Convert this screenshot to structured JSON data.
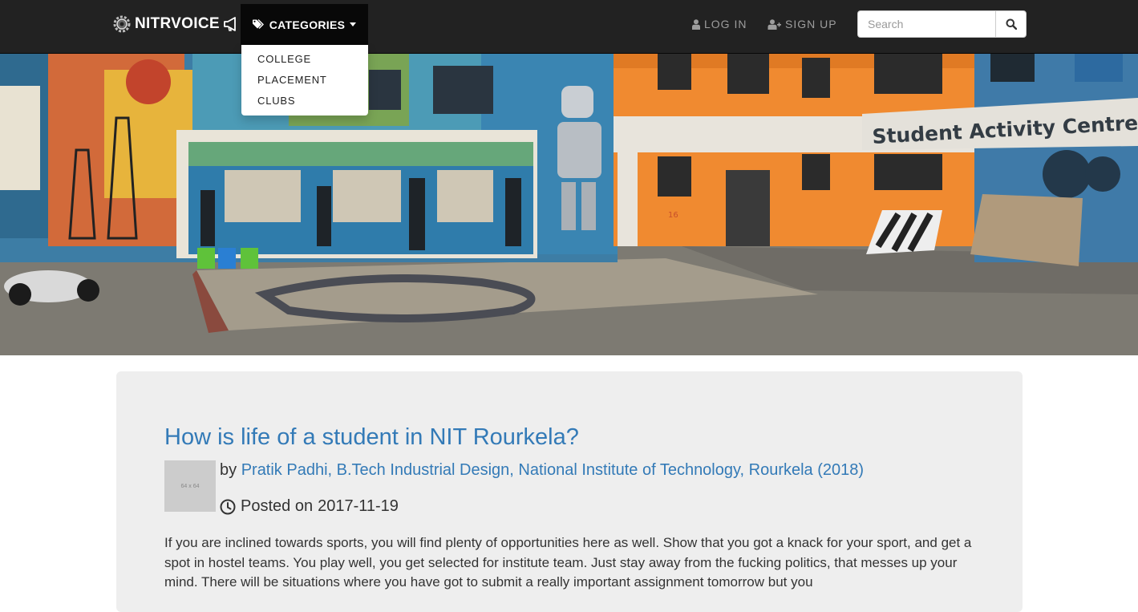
{
  "nav": {
    "brand": "NITRVOICE",
    "categories_label": "CATEGORIES",
    "categories_menu": [
      "COLLEGE",
      "PLACEMENT",
      "CLUBS"
    ],
    "login_label": "LOG IN",
    "signup_label": "SIGN UP",
    "search_placeholder": "Search"
  },
  "hero": {
    "sign_text": "Student Activity Centre",
    "wall_text": "16"
  },
  "post": {
    "title": "How is life of a student in NIT Rourkela?",
    "avatar_placeholder": "64 x 64",
    "by_prefix": "by",
    "author": "Pratik Padhi, B.Tech Industrial Design, National Institute of Technology, Rourkela (2018)",
    "posted_prefix": "Posted on",
    "date": "2017-11-19",
    "body": "If you are inclined towards sports, you will find plenty of opportunities here as well. Show that you got a knack for your sport, and get a spot in hostel teams. You play well, you get selected for institute team. Just stay away from the fucking politics, that messes up your mind. There will be situations where you have got to submit a really important assignment tomorrow but you"
  },
  "colors": {
    "navbar_bg": "#222222",
    "link": "#337ab7",
    "card_bg": "#eeeeee"
  }
}
